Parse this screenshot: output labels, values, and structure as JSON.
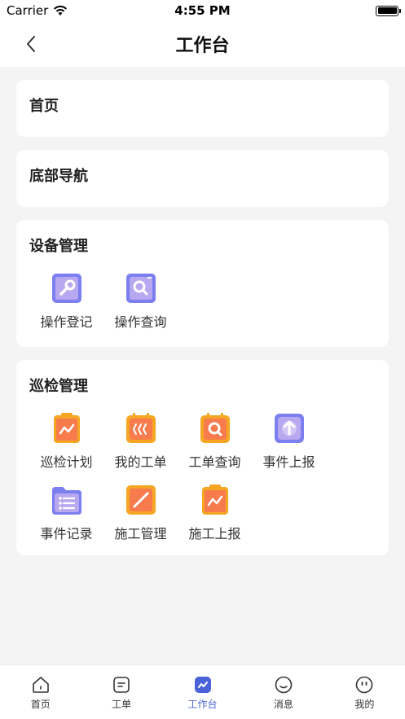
{
  "status_bar": {
    "carrier": "Carrier",
    "time": "4:55 PM"
  },
  "nav": {
    "title": "工作台"
  },
  "sections": [
    {
      "title": "首页"
    },
    {
      "title": "底部导航"
    },
    {
      "title": "设备管理",
      "items": [
        {
          "label": "操作登记",
          "icon": "wrench-icon"
        },
        {
          "label": "操作查询",
          "icon": "search-icon"
        }
      ]
    },
    {
      "title": "巡检管理",
      "items": [
        {
          "label": "巡检计划",
          "icon": "clipboard-trend-icon"
        },
        {
          "label": "我的工单",
          "icon": "work-order-icon"
        },
        {
          "label": "工单查询",
          "icon": "order-search-icon"
        },
        {
          "label": "事件上报",
          "icon": "upload-icon"
        },
        {
          "label": "事件记录",
          "icon": "folder-list-icon"
        },
        {
          "label": "施工管理",
          "icon": "pen-icon"
        },
        {
          "label": "施工上报",
          "icon": "clipboard-trend-icon"
        }
      ]
    }
  ],
  "tabs": [
    {
      "label": "首页",
      "icon": "home-icon",
      "active": false
    },
    {
      "label": "工单",
      "icon": "document-icon",
      "active": false
    },
    {
      "label": "工作台",
      "icon": "workbench-icon",
      "active": true
    },
    {
      "label": "消息",
      "icon": "message-icon",
      "active": false
    },
    {
      "label": "我的",
      "icon": "profile-icon",
      "active": false
    }
  ],
  "colors": {
    "accent": "#4b63d8",
    "orange": "#f5a623",
    "purple": "#7b7ff0",
    "background": "#f4f4f5"
  }
}
